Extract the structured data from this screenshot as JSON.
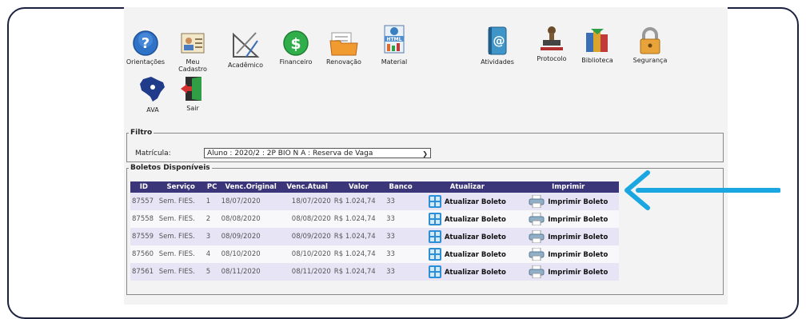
{
  "menu": {
    "items": [
      {
        "label": "Orientações",
        "icon": "help-icon"
      },
      {
        "label": "Meu\nCadastro",
        "icon": "profile-card-icon"
      },
      {
        "label": "Acadêmico",
        "icon": "drafting-tools-icon"
      },
      {
        "label": "Financeiro",
        "icon": "dollar-icon"
      },
      {
        "label": "Renovação",
        "icon": "folder-icon"
      },
      {
        "label": "Material",
        "icon": "html-file-icon"
      },
      {
        "label": "Atividades",
        "icon": "email-book-icon"
      },
      {
        "label": "Protocolo",
        "icon": "stamp-icon"
      },
      {
        "label": "Biblioteca",
        "icon": "books-icon"
      },
      {
        "label": "Segurança",
        "icon": "lock-icon"
      },
      {
        "label": "AVA",
        "icon": "brazil-map-icon"
      },
      {
        "label": "Sair",
        "icon": "exit-door-icon"
      }
    ]
  },
  "filter": {
    "legend": "Filtro",
    "matricula_label": "Matrícula:",
    "matricula_value": "Aluno : 2020/2 : 2P BIO N A : Reserva de Vaga"
  },
  "boletos": {
    "legend": "Boletos Disponíveis",
    "headers": [
      "ID",
      "Serviço",
      "PC",
      "Venc.Original",
      "Venc.Atual",
      "Valor",
      "Banco",
      "Atualizar",
      "Imprimir"
    ],
    "rows": [
      {
        "id": "87557",
        "servico": "Sem. FIES.",
        "pc": "1",
        "venc_original": "18/07/2020",
        "venc_atual": "18/07/2020",
        "valor": "R$ 1.024,74",
        "banco": "33",
        "atualizar": "Atualizar Boleto",
        "imprimir": "Imprimir Boleto"
      },
      {
        "id": "87558",
        "servico": "Sem. FIES.",
        "pc": "2",
        "venc_original": "08/08/2020",
        "venc_atual": "08/08/2020",
        "valor": "R$ 1.024,74",
        "banco": "33",
        "atualizar": "Atualizar Boleto",
        "imprimir": "Imprimir Boleto"
      },
      {
        "id": "87559",
        "servico": "Sem. FIES.",
        "pc": "3",
        "venc_original": "08/09/2020",
        "venc_atual": "08/09/2020",
        "valor": "R$ 1.024,74",
        "banco": "33",
        "atualizar": "Atualizar Boleto",
        "imprimir": "Imprimir Boleto"
      },
      {
        "id": "87560",
        "servico": "Sem. FIES.",
        "pc": "4",
        "venc_original": "08/10/2020",
        "venc_atual": "08/10/2020",
        "valor": "R$ 1.024,74",
        "banco": "33",
        "atualizar": "Atualizar Boleto",
        "imprimir": "Imprimir Boleto"
      },
      {
        "id": "87561",
        "servico": "Sem. FIES.",
        "pc": "5",
        "venc_original": "08/11/2020",
        "venc_atual": "08/11/2020",
        "valor": "R$ 1.024,74",
        "banco": "33",
        "atualizar": "Atualizar Boleto",
        "imprimir": "Imprimir Boleto"
      }
    ]
  },
  "colors": {
    "table_header": "#3b3579",
    "row_odd": "#e7e4f6",
    "annotation_arrow": "#1aa6e0"
  }
}
